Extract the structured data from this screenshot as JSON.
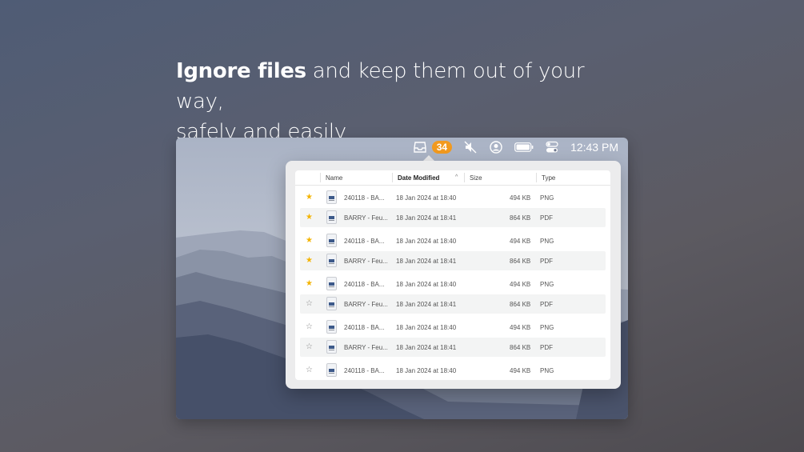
{
  "headline": {
    "bold": "Ignore files",
    "rest": " and keep them out of your way,",
    "line2": "safely and easily"
  },
  "menubar": {
    "badge": "34",
    "clock": "12:43 PM"
  },
  "table": {
    "columns": {
      "name": "Name",
      "date": "Date Modified",
      "size": "Size",
      "type": "Type"
    },
    "rows": [
      {
        "starred": true,
        "name": "240118 - BA...",
        "date": "18 Jan 2024 at 18:40",
        "size": "494 KB",
        "type": "PNG"
      },
      {
        "starred": true,
        "name": "BARRY - Feu...",
        "date": "18 Jan 2024 at 18:41",
        "size": "864 KB",
        "type": "PDF"
      },
      {
        "starred": true,
        "name": "240118 - BA...",
        "date": "18 Jan 2024 at 18:40",
        "size": "494 KB",
        "type": "PNG"
      },
      {
        "starred": true,
        "name": "BARRY - Feu...",
        "date": "18 Jan 2024 at 18:41",
        "size": "864 KB",
        "type": "PDF"
      },
      {
        "starred": true,
        "name": "240118 - BA...",
        "date": "18 Jan 2024 at 18:40",
        "size": "494 KB",
        "type": "PNG"
      },
      {
        "starred": false,
        "name": "BARRY - Feu...",
        "date": "18 Jan 2024 at 18:41",
        "size": "864 KB",
        "type": "PDF"
      },
      {
        "starred": false,
        "name": "240118 - BA...",
        "date": "18 Jan 2024 at 18:40",
        "size": "494 KB",
        "type": "PNG"
      },
      {
        "starred": false,
        "name": "BARRY - Feu...",
        "date": "18 Jan 2024 at 18:41",
        "size": "864 KB",
        "type": "PDF"
      },
      {
        "starred": false,
        "name": "240118 - BA...",
        "date": "18 Jan 2024 at 18:40",
        "size": "494 KB",
        "type": "PNG"
      }
    ]
  },
  "colors": {
    "badge": "#f29a1f",
    "star_on": "#f4b400",
    "star_off": "#888888"
  },
  "icons": [
    "inbox-tray-icon",
    "mute-icon",
    "user-circle-icon",
    "battery-icon",
    "control-center-icon",
    "star-icon",
    "file-icon",
    "sort-ascending-icon"
  ]
}
